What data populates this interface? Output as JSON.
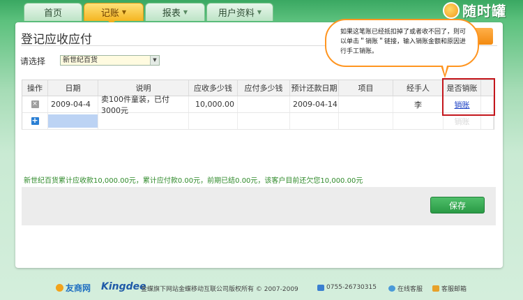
{
  "nav": {
    "tabs": [
      {
        "label": "首页",
        "active": false,
        "dropdown": false
      },
      {
        "label": "记账",
        "active": true,
        "dropdown": true
      },
      {
        "label": "报表",
        "active": false,
        "dropdown": true
      },
      {
        "label": "用户资料",
        "active": false,
        "dropdown": true
      }
    ],
    "caret": "▼"
  },
  "logo": {
    "text": "随时罐"
  },
  "page": {
    "title": "登记应收应付"
  },
  "filter": {
    "label": "请选择",
    "selected": "新世纪百货",
    "arrow": "▼"
  },
  "table": {
    "headers": [
      "操作",
      "日期",
      "说明",
      "应收多少钱",
      "应付多少钱",
      "预计还款日期",
      "项目",
      "经手人",
      "是否销账"
    ],
    "rows": [
      {
        "delete_icon": "×",
        "date": "2009-04-4",
        "desc": "卖100件童装，已付3000元",
        "receivable": "10,000.00",
        "payable": "",
        "due_date": "2009-04-14",
        "project": "",
        "handler": "李",
        "writeoff_link": "销账"
      }
    ],
    "new_row": {
      "add_icon": "+",
      "writeoff_placeholder": "销账"
    }
  },
  "tooltip": {
    "text": "如果这笔账已经抵扣掉了或者收不回了，则可以单击＂销账＂链接，输入销账金额和原因进行手工销账。"
  },
  "summary": "新世纪百货累计应收款10,000.00元，累计应付款0.00元，前期已结0.00元，该客户目前还欠您10,000.00元",
  "actions": {
    "save_label": "保存"
  },
  "footer": {
    "brand1": "友商网",
    "brand2": "Kingdee",
    "copyright": "金蝶旗下网站金蝶移动互联公司版权所有 © 2007-2009",
    "phone": "0755-26730315",
    "online_service": "在线客服",
    "mail_service": "客服邮箱"
  },
  "colors": {
    "accent": "#f4b521",
    "link": "#1a3fc4",
    "save": "#2a9a45",
    "highlight": "#c4161c",
    "tooltip_border": "#ff9520"
  }
}
